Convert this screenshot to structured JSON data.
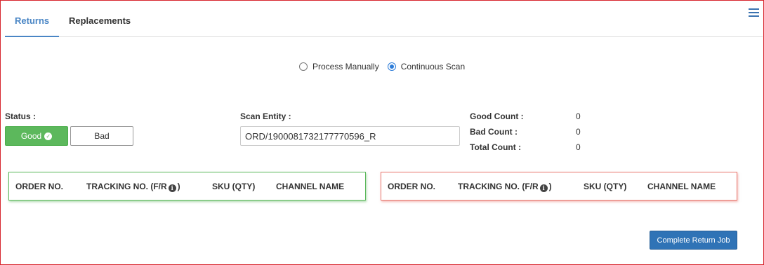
{
  "tabs": [
    {
      "label": "Returns",
      "active": true
    },
    {
      "label": "Replacements",
      "active": false
    }
  ],
  "menu_icon": "hamburger-menu-icon",
  "scan_mode": {
    "options": [
      {
        "label": "Process Manually",
        "checked": false
      },
      {
        "label": "Continuous Scan",
        "checked": true
      }
    ]
  },
  "status": {
    "label": "Status :",
    "good_label": "Good",
    "bad_label": "Bad",
    "selected": "Good"
  },
  "scan_entity": {
    "label": "Scan Entity :",
    "value": "ORD/1900081732177770596_R"
  },
  "counts": {
    "good_label": "Good Count :",
    "good_value": "0",
    "bad_label": "Bad Count :",
    "bad_value": "0",
    "total_label": "Total Count :",
    "total_value": "0"
  },
  "good_table": {
    "columns": [
      "ORDER NO.",
      "TRACKING NO. (F/R",
      ")",
      "SKU (QTY)",
      "CHANNEL NAME"
    ],
    "rows": []
  },
  "bad_table": {
    "columns": [
      "ORDER NO.",
      "TRACKING NO. (F/R",
      ")",
      "SKU (QTY)",
      "CHANNEL NAME"
    ],
    "rows": []
  },
  "complete_button": "Complete Return Job",
  "colors": {
    "accent": "#4a86c5",
    "good": "#5cb85c",
    "bad": "#e8776e",
    "primary_button": "#2f73b6",
    "frame_border": "#d7262d"
  }
}
